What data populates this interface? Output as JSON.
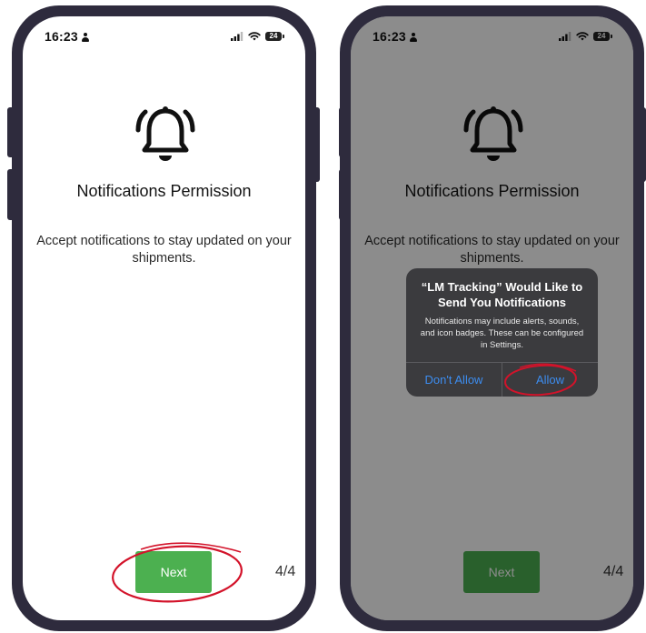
{
  "status_bar": {
    "time": "16:23",
    "battery": "24"
  },
  "onboarding": {
    "title": "Notifications Permission",
    "description": "Accept notifications to stay updated on your shipments.",
    "next_label": "Next",
    "pager": "4/4"
  },
  "permission_alert": {
    "title": "“LM Tracking” Would Like to Send You Notifications",
    "message": "Notifications may include alerts, sounds, and icon badges. These can be configured in Settings.",
    "deny_label": "Don't Allow",
    "allow_label": "Allow"
  },
  "colors": {
    "phone_frame": "#2e2b3d",
    "next_button": "#4cb050",
    "annotation_circle": "#d3132a",
    "alert_button_text": "#3c8df0"
  }
}
